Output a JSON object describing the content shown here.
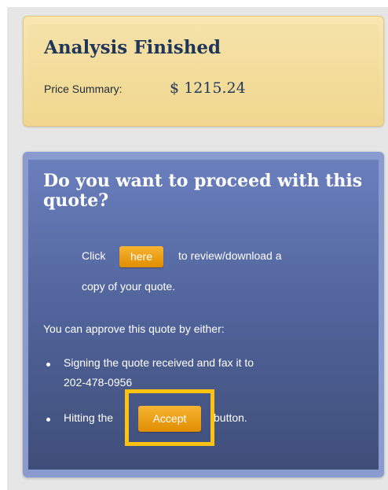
{
  "summary": {
    "title": "Analysis Finished",
    "price_label": "Price Summary:",
    "price_value": "$ 1215.24"
  },
  "quote": {
    "title": "Do you want to proceed with this quote?",
    "review_prefix": "Click",
    "here_button": "here",
    "review_suffix": "to review/download a",
    "review_line2": "copy of your quote.",
    "approve_intro": "You can approve this quote by either:",
    "bullet1_line1": "Signing the quote received and fax it to",
    "bullet1_line2": "202-478-0956",
    "bullet2_prefix": "Hitting the",
    "accept_button": "Accept",
    "bullet2_suffix": "button."
  },
  "colors": {
    "accent_orange": "#f0a020",
    "highlight": "#ffc20e",
    "summary_bg": "#f3dc9c",
    "quote_bg": "#4f6297",
    "title_navy": "#1f3659"
  }
}
